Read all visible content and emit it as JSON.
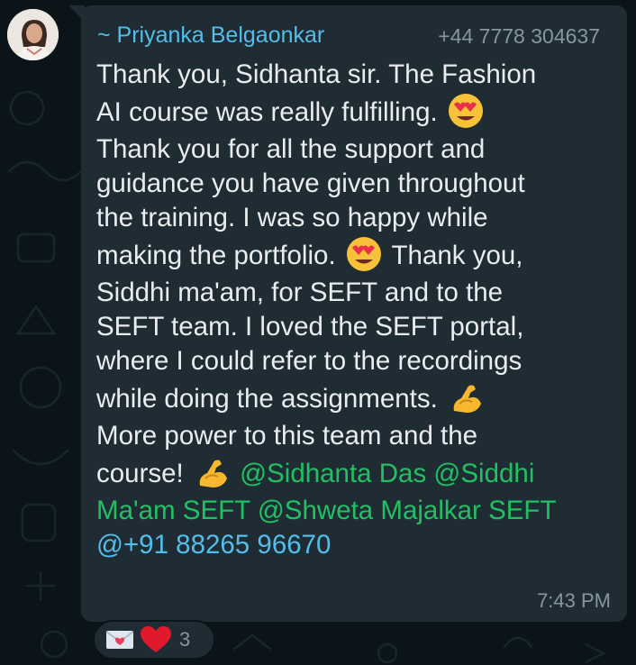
{
  "sender": {
    "name": "~ Priyanka Belgaonkar",
    "phone": "+44 7778 304637",
    "avatar_icon": "profile-photo"
  },
  "message": {
    "lines": [
      "Thank you, Sidhanta sir. The Fashion",
      "AI course was really fulfilling.",
      "Thank you for all the support and",
      "guidance you have given throughout",
      "the training. I was so happy while",
      "making the portfolio.",
      "Thank you,",
      "Siddhi ma'am, for SEFT and to the",
      "SEFT team. I loved the SEFT portal,",
      "where I could refer to the recordings",
      "while doing the assignments.",
      "More power to this team and the",
      "course!"
    ],
    "mentions": [
      "@Sidhanta Das",
      "@Siddhi",
      "Ma'am SEFT",
      "@Shweta Majalkar SEFT"
    ],
    "phone_link": "@+91 88265 96670",
    "time": "7:43 PM"
  },
  "reactions": {
    "icons": [
      "love-letter-icon",
      "red-heart-icon"
    ],
    "count": "3"
  },
  "colors": {
    "background": "#0b1418",
    "bubble": "#202c33",
    "text": "#e9edef",
    "sender": "#53bdeb",
    "mention": "#21c063",
    "link": "#53bdeb",
    "meta": "#8696a0"
  }
}
